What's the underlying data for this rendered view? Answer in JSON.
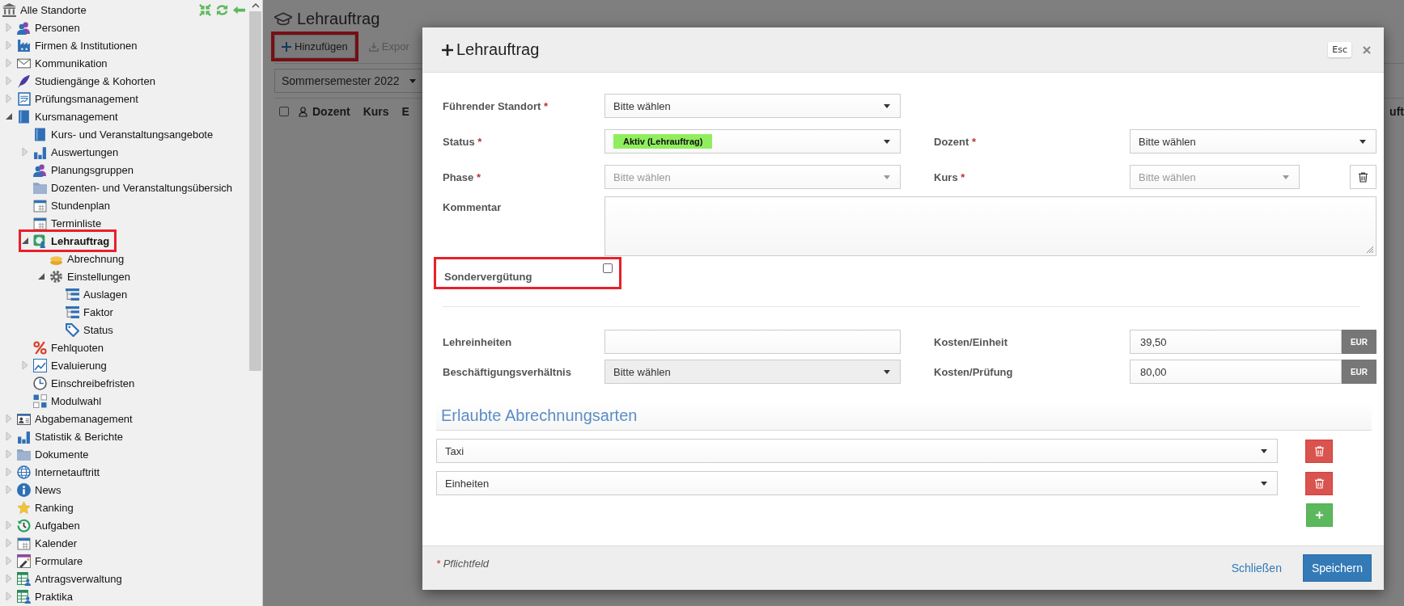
{
  "sidebar": {
    "root": "Alle Standorte",
    "items": [
      {
        "label": "Personen",
        "expanded": false,
        "selected": false,
        "highlighted": false
      },
      {
        "label": "Firmen & Institutionen",
        "expanded": false,
        "selected": false,
        "highlighted": false
      },
      {
        "label": "Kommunikation",
        "expanded": false,
        "selected": false,
        "highlighted": false
      },
      {
        "label": "Studiengänge & Kohorten",
        "expanded": false,
        "selected": false,
        "highlighted": false
      },
      {
        "label": "Prüfungsmanagement",
        "expanded": false,
        "selected": false,
        "highlighted": false
      },
      {
        "label": "Kursmanagement",
        "expanded": true,
        "selected": false,
        "highlighted": false,
        "children": [
          {
            "label": "Kurs- und Veranstaltungsangebote",
            "selected": false,
            "highlighted": false
          },
          {
            "label": "Auswertungen",
            "expanded": false,
            "selected": false,
            "highlighted": false
          },
          {
            "label": "Planungsgruppen",
            "selected": false,
            "highlighted": false
          },
          {
            "label": "Dozenten- und Veranstaltungsübersich",
            "selected": false,
            "highlighted": false
          },
          {
            "label": "Stundenplan",
            "selected": false,
            "highlighted": false
          },
          {
            "label": "Terminliste",
            "selected": false,
            "highlighted": false
          },
          {
            "label": "Lehrauftrag",
            "expanded": true,
            "selected": true,
            "highlighted": true,
            "children": [
              {
                "label": "Abrechnung",
                "selected": false,
                "highlighted": false
              },
              {
                "label": "Einstellungen",
                "expanded": true,
                "selected": false,
                "highlighted": false,
                "children": [
                  {
                    "label": "Auslagen",
                    "selected": false,
                    "highlighted": false
                  },
                  {
                    "label": "Faktor",
                    "selected": false,
                    "highlighted": false
                  },
                  {
                    "label": "Status",
                    "selected": false,
                    "highlighted": false
                  }
                ]
              }
            ]
          },
          {
            "label": "Fehlquoten",
            "selected": false,
            "highlighted": false
          },
          {
            "label": "Evaluierung",
            "expanded": false,
            "selected": false,
            "highlighted": false
          },
          {
            "label": "Einschreibefristen",
            "selected": false,
            "highlighted": false
          },
          {
            "label": "Modulwahl",
            "selected": false,
            "highlighted": false
          }
        ]
      },
      {
        "label": "Abgabemanagement",
        "expanded": false,
        "selected": false,
        "highlighted": false
      },
      {
        "label": "Statistik & Berichte",
        "expanded": false,
        "selected": false,
        "highlighted": false
      },
      {
        "label": "Dokumente",
        "expanded": false,
        "selected": false,
        "highlighted": false
      },
      {
        "label": "Internetauftritt",
        "expanded": false,
        "selected": false,
        "highlighted": false
      },
      {
        "label": "News",
        "expanded": false,
        "selected": false,
        "highlighted": false
      },
      {
        "label": "Ranking",
        "selected": false,
        "highlighted": false
      },
      {
        "label": "Aufgaben",
        "expanded": false,
        "selected": false,
        "highlighted": false
      },
      {
        "label": "Kalender",
        "expanded": false,
        "selected": false,
        "highlighted": false
      },
      {
        "label": "Formulare",
        "expanded": false,
        "selected": false,
        "highlighted": false
      },
      {
        "label": "Antragsverwaltung",
        "expanded": false,
        "selected": false,
        "highlighted": false
      },
      {
        "label": "Praktika",
        "expanded": false,
        "selected": false,
        "highlighted": false
      }
    ]
  },
  "page": {
    "title": "Lehrauftrag",
    "toolbar": [
      {
        "label": "Hinzufügen",
        "kind": "add",
        "disabled": false,
        "highlighted": true
      },
      {
        "label": "Expor",
        "kind": "export",
        "disabled": true,
        "highlighted": false
      }
    ],
    "semester": "Sommersemester 2022",
    "table_header": {
      "checked": false,
      "columns": [
        {
          "label": "Dozent",
          "kind": "person"
        },
        {
          "label": "Kurs",
          "kind": "plain"
        },
        {
          "label": "E",
          "kind": "plain"
        },
        {
          "label": "uft",
          "kind": "end"
        }
      ]
    }
  },
  "modal": {
    "title": "Lehrauftrag",
    "esc_hint": "Esc",
    "standort": {
      "label": "Führender Standort",
      "mark": "*",
      "value": "Bitte wählen",
      "disabled": false
    },
    "status": {
      "label": "Status",
      "mark": "*",
      "badge": "Aktiv (Lehrauftrag)",
      "color": "#90ee5e",
      "disabled": false
    },
    "dozent": {
      "label": "Dozent",
      "mark": "*",
      "value": "Bitte wählen",
      "disabled": false
    },
    "phase": {
      "label": "Phase",
      "mark": "*",
      "value": "Bitte wählen",
      "disabled": true
    },
    "kurs": {
      "label": "Kurs",
      "mark": "*",
      "value": "Bitte wählen",
      "disabled": true
    },
    "kommentar": {
      "label": "Kommentar"
    },
    "sonderverguetung": {
      "label": "Sondervergütung",
      "checked": false,
      "highlighted": true
    },
    "lehreinheiten": {
      "label": "Lehreinheiten"
    },
    "beschaeftigung": {
      "label": "Beschäftigungsverhältnis",
      "value": "Bitte wählen",
      "readonly": true
    },
    "kosten_einheit": {
      "label": "Kosten/Einheit",
      "value": "39,50",
      "unit": "EUR"
    },
    "kosten_pruefung": {
      "label": "Kosten/Prüfung",
      "value": "80,00",
      "unit": "EUR"
    },
    "abrechnungsarten": {
      "title": "Erlaubte Abrechnungsarten",
      "items": [
        {
          "value": "Taxi"
        },
        {
          "value": "Einheiten"
        }
      ]
    },
    "footer": {
      "mark": "*",
      "note": "Pflichtfeld",
      "close": "Schließen",
      "save": "Speichern"
    }
  }
}
